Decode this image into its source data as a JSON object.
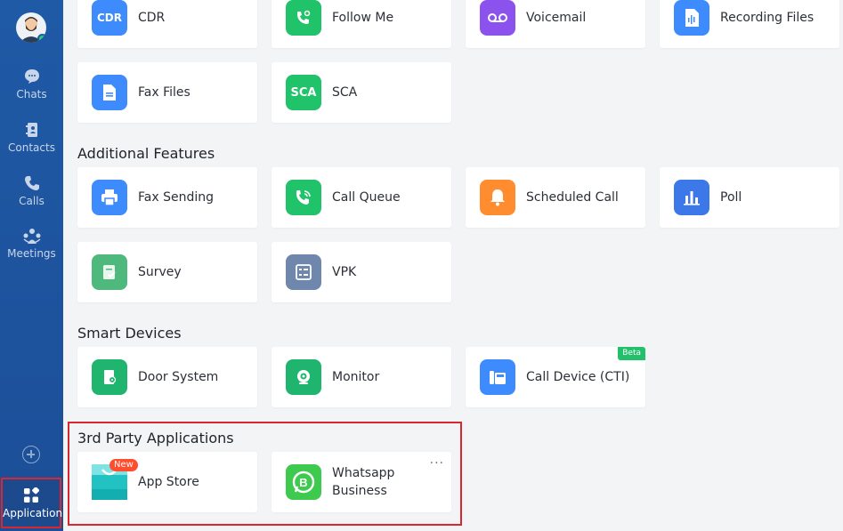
{
  "sidebar": {
    "items": [
      {
        "label": "Chats",
        "icon": "chat-icon"
      },
      {
        "label": "Contacts",
        "icon": "contacts-icon"
      },
      {
        "label": "Calls",
        "icon": "phone-icon"
      },
      {
        "label": "Meetings",
        "icon": "meetings-icon"
      }
    ],
    "add_icon": "plus-circle-icon",
    "application": {
      "label": "Application",
      "icon": "apps-grid-icon",
      "active": true
    }
  },
  "top_row": [
    {
      "label": "CDR",
      "icon_text": "CDR",
      "color": "#3d8bfd"
    },
    {
      "label": "Follow Me",
      "icon": "follow-me-phone-icon",
      "color": "#20c26a"
    },
    {
      "label": "Voicemail",
      "icon": "voicemail-icon",
      "color": "#8c52ee"
    },
    {
      "label": "Recording Files",
      "icon": "recording-file-icon",
      "color": "#3d8bfd"
    }
  ],
  "second_row": [
    {
      "label": "Fax Files",
      "icon": "fax-file-icon",
      "color": "#3d8bfd"
    },
    {
      "label": "SCA",
      "icon_text": "SCA",
      "color": "#20c26a"
    }
  ],
  "additional_features": {
    "title": "Additional Features",
    "items": [
      {
        "label": "Fax Sending",
        "icon": "printer-icon",
        "color": "#3d8bfd"
      },
      {
        "label": "Call Queue",
        "icon": "call-queue-icon",
        "color": "#20c26a"
      },
      {
        "label": "Scheduled Call",
        "icon": "bell-icon",
        "color": "#ff8c2e"
      },
      {
        "label": "Poll",
        "icon": "bar-chart-icon",
        "color": "#3d78e8"
      },
      {
        "label": "Survey",
        "icon": "survey-icon",
        "color": "#4fb87d"
      },
      {
        "label": "VPK",
        "icon": "vpk-icon",
        "color": "#6f86ad"
      }
    ]
  },
  "smart_devices": {
    "title": "Smart Devices",
    "items": [
      {
        "label": "Door System",
        "icon": "door-system-icon",
        "color": "#20b56e"
      },
      {
        "label": "Monitor",
        "icon": "camera-icon",
        "color": "#20b56e"
      },
      {
        "label": "Call Device (CTI)",
        "icon": "desk-phone-icon",
        "color": "#3d8bfd",
        "badge": "Beta"
      }
    ]
  },
  "third_party": {
    "title": "3rd Party Applications",
    "items": [
      {
        "label": "App Store",
        "icon": "app-store-icon",
        "color": "#22c2c2",
        "badge": "New"
      },
      {
        "label": "Whatsapp Business",
        "icon": "whatsapp-business-icon",
        "color": "#3dca4f",
        "more": "···"
      }
    ]
  }
}
